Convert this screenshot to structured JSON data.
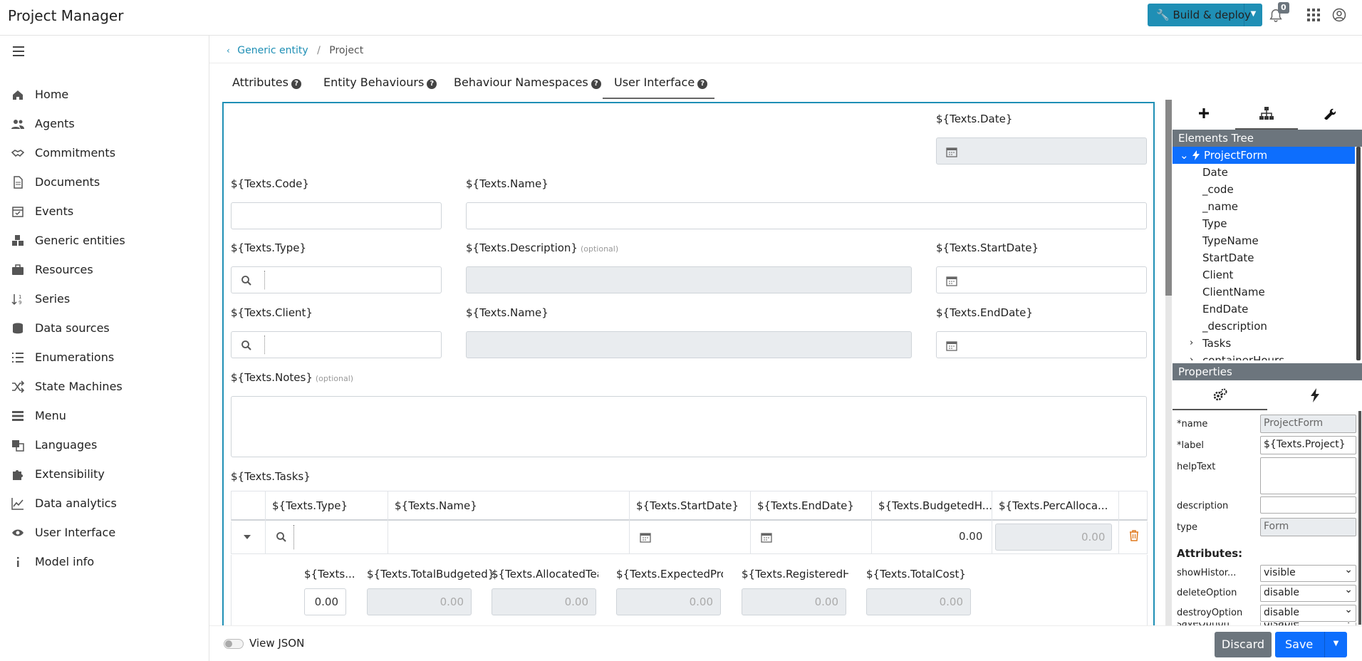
{
  "app": {
    "title": "Project Manager"
  },
  "topbar": {
    "build_label": "Build & deploy",
    "notifications_count": "0"
  },
  "sidebar": {
    "items": [
      {
        "label": "Home",
        "icon": "home-icon"
      },
      {
        "label": "Agents",
        "icon": "users-icon"
      },
      {
        "label": "Commitments",
        "icon": "handshake-icon"
      },
      {
        "label": "Documents",
        "icon": "document-icon"
      },
      {
        "label": "Events",
        "icon": "calendar-check-icon"
      },
      {
        "label": "Generic entities",
        "icon": "cubes-icon"
      },
      {
        "label": "Resources",
        "icon": "briefcase-icon"
      },
      {
        "label": "Series",
        "icon": "sort-numeric-icon"
      },
      {
        "label": "Data sources",
        "icon": "database-icon"
      },
      {
        "label": "Enumerations",
        "icon": "list-icon"
      },
      {
        "label": "State Machines",
        "icon": "random-icon"
      },
      {
        "label": "Menu",
        "icon": "menu-list-icon"
      },
      {
        "label": "Languages",
        "icon": "language-icon"
      },
      {
        "label": "Extensibility",
        "icon": "puzzle-icon"
      },
      {
        "label": "Data analytics",
        "icon": "line-chart-icon"
      },
      {
        "label": "User Interface",
        "icon": "eye-icon"
      },
      {
        "label": "Model info",
        "icon": "info-icon"
      }
    ]
  },
  "breadcrumb": {
    "parent": "Generic entity",
    "current": "Project"
  },
  "tabs": [
    {
      "label": "Attributes"
    },
    {
      "label": "Entity Behaviours"
    },
    {
      "label": "Behaviour Namespaces"
    },
    {
      "label": "User Interface"
    }
  ],
  "form": {
    "date_label": "${Texts.Date}",
    "code_label": "${Texts.Code}",
    "name_label": "${Texts.Name}",
    "type_label": "${Texts.Type}",
    "description_label": "${Texts.Description}",
    "optional": "(optional)",
    "startdate_label": "${Texts.StartDate}",
    "client_label": "${Texts.Client}",
    "clientname_label": "${Texts.Name}",
    "enddate_label": "${Texts.EndDate}",
    "notes_label": "${Texts.Notes}",
    "tasks_label": "${Texts.Tasks}"
  },
  "tasks_grid": {
    "columns": [
      "${Texts.Type}",
      "${Texts.Name}",
      "${Texts.StartDate}",
      "${Texts.EndDate}",
      "${Texts.BudgetedH...",
      "${Texts.PercAlloca..."
    ],
    "row": {
      "budgeted": "0.00",
      "percalloc": "0.00"
    },
    "detail_labels": [
      "${Texts....",
      "${Texts.TotalBudgeted}",
      "${Texts.AllocatedTeam...",
      "${Texts.ExpectedProfit...",
      "${Texts.RegisteredHou...",
      "${Texts.TotalCost}"
    ],
    "detail_values": [
      "0.00",
      "0.00",
      "0.00",
      "0.00",
      "0.00",
      "0.00"
    ]
  },
  "footer": {
    "view_json": "View JSON",
    "discard": "Discard",
    "save": "Save"
  },
  "right_panel": {
    "elements_tree_title": "Elements Tree",
    "tree": [
      {
        "label": "ProjectForm",
        "selected": true
      },
      {
        "label": "Date"
      },
      {
        "label": "_code"
      },
      {
        "label": "_name"
      },
      {
        "label": "Type"
      },
      {
        "label": "TypeName"
      },
      {
        "label": "StartDate"
      },
      {
        "label": "Client"
      },
      {
        "label": "ClientName"
      },
      {
        "label": "EndDate"
      },
      {
        "label": "_description"
      },
      {
        "label": "Tasks"
      },
      {
        "label": "containerHours"
      }
    ],
    "properties_title": "Properties",
    "props": {
      "name_label": "*name",
      "name_value": "ProjectForm",
      "label_label": "*label",
      "label_value": "${Texts.Project}",
      "helptext_label": "helpText",
      "description_label": "description",
      "type_label": "type",
      "type_value": "Form"
    },
    "attributes_title": "Attributes:",
    "attributes": [
      {
        "label": "showHistor...",
        "value": "visible"
      },
      {
        "label": "deleteOption",
        "value": "disable"
      },
      {
        "label": "destroyOption",
        "value": "disable"
      },
      {
        "label": "saveOption",
        "value": "disable"
      }
    ]
  }
}
